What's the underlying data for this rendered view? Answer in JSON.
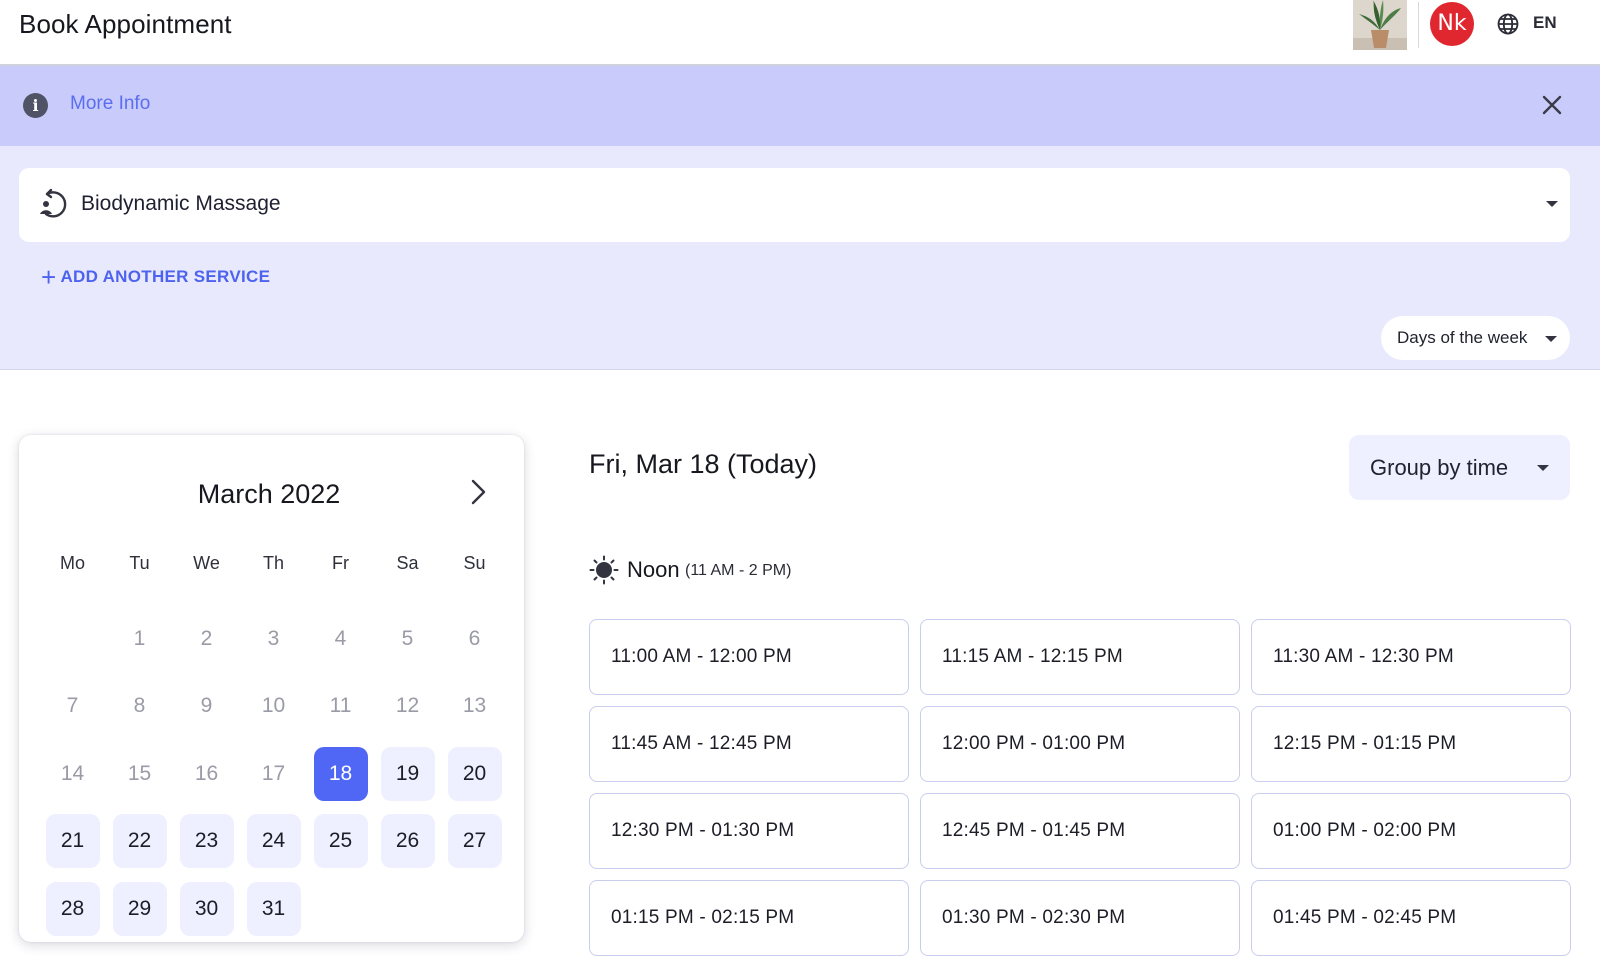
{
  "header": {
    "title": "Book Appointment",
    "avatar_initials": "Nk",
    "language": "EN"
  },
  "banner": {
    "more_info": "More Info"
  },
  "service": {
    "selected": "Biodynamic Massage",
    "add_another": "ADD ANOTHER SERVICE",
    "days_filter": "Days of the week"
  },
  "calendar": {
    "month_label": "March 2022",
    "weekdays": [
      "Mo",
      "Tu",
      "We",
      "Th",
      "Fr",
      "Sa",
      "Su"
    ],
    "leading_blanks": 1,
    "days": [
      {
        "d": "1",
        "state": "disabled"
      },
      {
        "d": "2",
        "state": "disabled"
      },
      {
        "d": "3",
        "state": "disabled"
      },
      {
        "d": "4",
        "state": "disabled"
      },
      {
        "d": "5",
        "state": "disabled"
      },
      {
        "d": "6",
        "state": "disabled"
      },
      {
        "d": "7",
        "state": "disabled"
      },
      {
        "d": "8",
        "state": "disabled"
      },
      {
        "d": "9",
        "state": "disabled"
      },
      {
        "d": "10",
        "state": "disabled"
      },
      {
        "d": "11",
        "state": "disabled"
      },
      {
        "d": "12",
        "state": "disabled"
      },
      {
        "d": "13",
        "state": "disabled"
      },
      {
        "d": "14",
        "state": "disabled"
      },
      {
        "d": "15",
        "state": "disabled"
      },
      {
        "d": "16",
        "state": "disabled"
      },
      {
        "d": "17",
        "state": "disabled"
      },
      {
        "d": "18",
        "state": "selected"
      },
      {
        "d": "19",
        "state": "available"
      },
      {
        "d": "20",
        "state": "available"
      },
      {
        "d": "21",
        "state": "available"
      },
      {
        "d": "22",
        "state": "available"
      },
      {
        "d": "23",
        "state": "available"
      },
      {
        "d": "24",
        "state": "available"
      },
      {
        "d": "25",
        "state": "available"
      },
      {
        "d": "26",
        "state": "available"
      },
      {
        "d": "27",
        "state": "available"
      },
      {
        "d": "28",
        "state": "available"
      },
      {
        "d": "29",
        "state": "available"
      },
      {
        "d": "30",
        "state": "available"
      },
      {
        "d": "31",
        "state": "available"
      }
    ]
  },
  "schedule": {
    "date_heading": "Fri, Mar 18 (Today)",
    "group_by": "Group by time",
    "period_name": "Noon",
    "period_range": "(11 AM - 2 PM)",
    "slots": [
      "11:00 AM - 12:00 PM",
      "11:15 AM - 12:15 PM",
      "11:30 AM - 12:30 PM",
      "11:45 AM - 12:45 PM",
      "12:00 PM - 01:00 PM",
      "12:15 PM - 01:15 PM",
      "12:30 PM - 01:30 PM",
      "12:45 PM - 01:45 PM",
      "01:00 PM - 02:00 PM",
      "01:15 PM - 02:15 PM",
      "01:30 PM - 02:30 PM",
      "01:45 PM - 02:45 PM"
    ]
  },
  "colors": {
    "accent": "#4f67f4",
    "banner_bg": "#c9cbfb",
    "panel_bg": "#e8e9fd",
    "avatar_bg": "#e0262f"
  },
  "icons": {
    "info": "info-icon",
    "close": "close-icon",
    "service": "massage-icon",
    "globe": "globe-icon",
    "sun": "sun-icon",
    "next": "chevron-right-icon"
  }
}
